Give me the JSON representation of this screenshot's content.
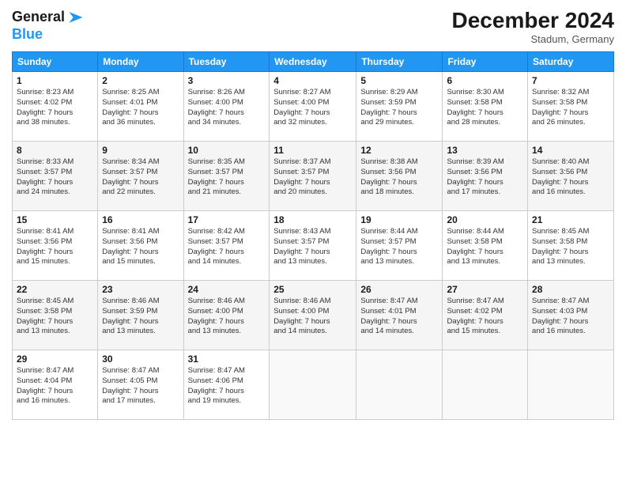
{
  "logo": {
    "line1": "General",
    "line2": "Blue",
    "arrow_color": "#2196F3"
  },
  "title": "December 2024",
  "location": "Stadum, Germany",
  "header_days": [
    "Sunday",
    "Monday",
    "Tuesday",
    "Wednesday",
    "Thursday",
    "Friday",
    "Saturday"
  ],
  "weeks": [
    [
      {
        "day": "1",
        "info": "Sunrise: 8:23 AM\nSunset: 4:02 PM\nDaylight: 7 hours\nand 38 minutes."
      },
      {
        "day": "2",
        "info": "Sunrise: 8:25 AM\nSunset: 4:01 PM\nDaylight: 7 hours\nand 36 minutes."
      },
      {
        "day": "3",
        "info": "Sunrise: 8:26 AM\nSunset: 4:00 PM\nDaylight: 7 hours\nand 34 minutes."
      },
      {
        "day": "4",
        "info": "Sunrise: 8:27 AM\nSunset: 4:00 PM\nDaylight: 7 hours\nand 32 minutes."
      },
      {
        "day": "5",
        "info": "Sunrise: 8:29 AM\nSunset: 3:59 PM\nDaylight: 7 hours\nand 29 minutes."
      },
      {
        "day": "6",
        "info": "Sunrise: 8:30 AM\nSunset: 3:58 PM\nDaylight: 7 hours\nand 28 minutes."
      },
      {
        "day": "7",
        "info": "Sunrise: 8:32 AM\nSunset: 3:58 PM\nDaylight: 7 hours\nand 26 minutes."
      }
    ],
    [
      {
        "day": "8",
        "info": "Sunrise: 8:33 AM\nSunset: 3:57 PM\nDaylight: 7 hours\nand 24 minutes."
      },
      {
        "day": "9",
        "info": "Sunrise: 8:34 AM\nSunset: 3:57 PM\nDaylight: 7 hours\nand 22 minutes."
      },
      {
        "day": "10",
        "info": "Sunrise: 8:35 AM\nSunset: 3:57 PM\nDaylight: 7 hours\nand 21 minutes."
      },
      {
        "day": "11",
        "info": "Sunrise: 8:37 AM\nSunset: 3:57 PM\nDaylight: 7 hours\nand 20 minutes."
      },
      {
        "day": "12",
        "info": "Sunrise: 8:38 AM\nSunset: 3:56 PM\nDaylight: 7 hours\nand 18 minutes."
      },
      {
        "day": "13",
        "info": "Sunrise: 8:39 AM\nSunset: 3:56 PM\nDaylight: 7 hours\nand 17 minutes."
      },
      {
        "day": "14",
        "info": "Sunrise: 8:40 AM\nSunset: 3:56 PM\nDaylight: 7 hours\nand 16 minutes."
      }
    ],
    [
      {
        "day": "15",
        "info": "Sunrise: 8:41 AM\nSunset: 3:56 PM\nDaylight: 7 hours\nand 15 minutes."
      },
      {
        "day": "16",
        "info": "Sunrise: 8:41 AM\nSunset: 3:56 PM\nDaylight: 7 hours\nand 15 minutes."
      },
      {
        "day": "17",
        "info": "Sunrise: 8:42 AM\nSunset: 3:57 PM\nDaylight: 7 hours\nand 14 minutes."
      },
      {
        "day": "18",
        "info": "Sunrise: 8:43 AM\nSunset: 3:57 PM\nDaylight: 7 hours\nand 13 minutes."
      },
      {
        "day": "19",
        "info": "Sunrise: 8:44 AM\nSunset: 3:57 PM\nDaylight: 7 hours\nand 13 minutes."
      },
      {
        "day": "20",
        "info": "Sunrise: 8:44 AM\nSunset: 3:58 PM\nDaylight: 7 hours\nand 13 minutes."
      },
      {
        "day": "21",
        "info": "Sunrise: 8:45 AM\nSunset: 3:58 PM\nDaylight: 7 hours\nand 13 minutes."
      }
    ],
    [
      {
        "day": "22",
        "info": "Sunrise: 8:45 AM\nSunset: 3:58 PM\nDaylight: 7 hours\nand 13 minutes."
      },
      {
        "day": "23",
        "info": "Sunrise: 8:46 AM\nSunset: 3:59 PM\nDaylight: 7 hours\nand 13 minutes."
      },
      {
        "day": "24",
        "info": "Sunrise: 8:46 AM\nSunset: 4:00 PM\nDaylight: 7 hours\nand 13 minutes."
      },
      {
        "day": "25",
        "info": "Sunrise: 8:46 AM\nSunset: 4:00 PM\nDaylight: 7 hours\nand 14 minutes."
      },
      {
        "day": "26",
        "info": "Sunrise: 8:47 AM\nSunset: 4:01 PM\nDaylight: 7 hours\nand 14 minutes."
      },
      {
        "day": "27",
        "info": "Sunrise: 8:47 AM\nSunset: 4:02 PM\nDaylight: 7 hours\nand 15 minutes."
      },
      {
        "day": "28",
        "info": "Sunrise: 8:47 AM\nSunset: 4:03 PM\nDaylight: 7 hours\nand 16 minutes."
      }
    ],
    [
      {
        "day": "29",
        "info": "Sunrise: 8:47 AM\nSunset: 4:04 PM\nDaylight: 7 hours\nand 16 minutes."
      },
      {
        "day": "30",
        "info": "Sunrise: 8:47 AM\nSunset: 4:05 PM\nDaylight: 7 hours\nand 17 minutes."
      },
      {
        "day": "31",
        "info": "Sunrise: 8:47 AM\nSunset: 4:06 PM\nDaylight: 7 hours\nand 19 minutes."
      },
      null,
      null,
      null,
      null
    ]
  ]
}
